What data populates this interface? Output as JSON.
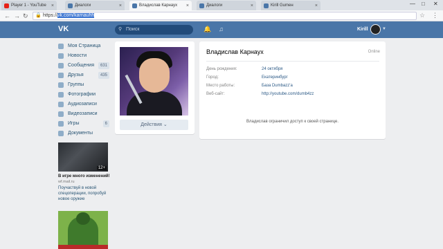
{
  "browser": {
    "tabs": [
      {
        "title": "Player 1 - YouTube",
        "color": "#e62117",
        "active": false
      },
      {
        "title": "Диалоги",
        "color": "#4a76a8",
        "active": false
      },
      {
        "title": "Владислав Карнаух",
        "color": "#4a76a8",
        "active": true
      },
      {
        "title": "Диалоги",
        "color": "#4a76a8",
        "active": false
      },
      {
        "title": "Kirill Gumeн",
        "color": "#4a76a8",
        "active": false
      }
    ],
    "url_prefix": "https://",
    "url_selected": "vk.com/karnauhh",
    "minimize": "—",
    "maximize": "□",
    "close": "✕"
  },
  "header": {
    "logo": "VK",
    "search_placeholder": "Поиск",
    "user_name": "Kirill"
  },
  "sidebar": {
    "items": [
      {
        "label": "Моя Страница",
        "count": ""
      },
      {
        "label": "Новости",
        "count": ""
      },
      {
        "label": "Сообщения",
        "count": "631"
      },
      {
        "label": "Друзья",
        "count": "435"
      },
      {
        "label": "Группы",
        "count": ""
      },
      {
        "label": "Фотографии",
        "count": ""
      },
      {
        "label": "Аудиозаписи",
        "count": ""
      },
      {
        "label": "Видеозаписи",
        "count": ""
      },
      {
        "label": "Игры",
        "count": "6"
      },
      {
        "label": "Документы",
        "count": ""
      }
    ]
  },
  "ads": {
    "ad1_badge": "12+",
    "ad1_title": "В игре много изменений!",
    "ad1_source": "wf.mail.ru",
    "ad1_text": "Поучаствуй в новой спецоперации, попробуй новое оружие"
  },
  "profile": {
    "action_button": "Действия ⌄",
    "name": "Владислав Карнаух",
    "status": "Online",
    "rows": [
      {
        "label": "День рождения:",
        "value": "24 октября"
      },
      {
        "label": "Город:",
        "value": "Екатеринбург"
      },
      {
        "label": "Место работы:",
        "value": "База Dumbazz'a"
      },
      {
        "label": "Веб-сайт:",
        "value": "http://youtube.com/dumb4zz"
      }
    ],
    "restricted": "Владислав ограничил доступ к своей странице."
  }
}
